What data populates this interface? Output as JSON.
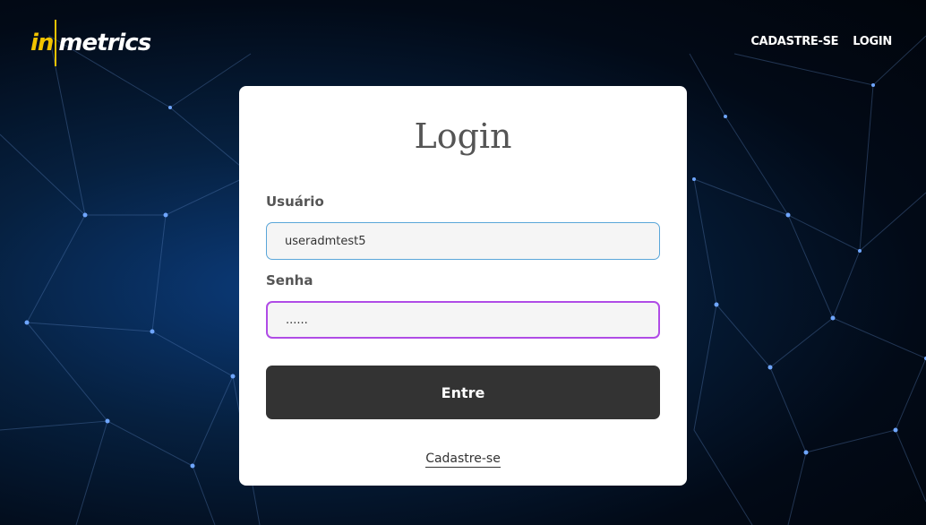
{
  "brand": {
    "part1": "in",
    "part2": "metrics"
  },
  "nav": {
    "signup": "CADASTRE-SE",
    "login": "LOGIN"
  },
  "form": {
    "title": "Login",
    "username_label": "Usuário",
    "username_value": "useradmtest5",
    "password_label": "Senha",
    "password_value": "......",
    "submit_label": "Entre",
    "signup_link": "Cadastre-se"
  },
  "colors": {
    "brand_yellow": "#f2c300",
    "button": "#333333",
    "focus_border": "#b04ce6",
    "user_border": "#5aa6d9"
  }
}
